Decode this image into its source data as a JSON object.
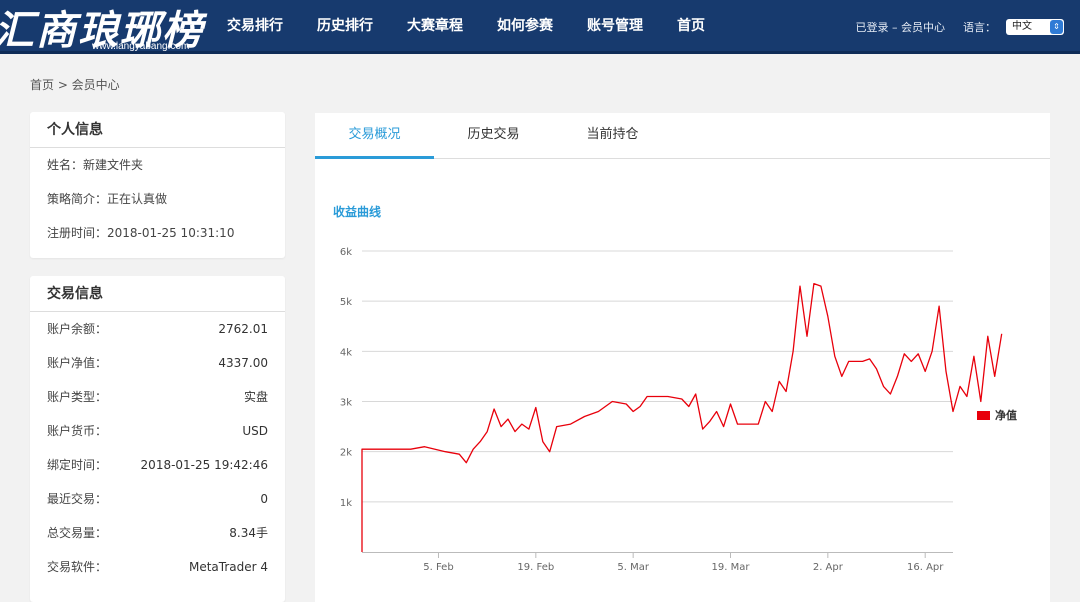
{
  "header": {
    "logo_text": "汇商琅琊榜",
    "logo_url": "www.langyabang.com",
    "nav": [
      "交易排行",
      "历史排行",
      "大赛章程",
      "如何参赛",
      "账号管理",
      "首页"
    ],
    "login_status": "已登录 – 会员中心",
    "language_label": "语言：",
    "language_value": "中文"
  },
  "breadcrumb": "首页 > 会员中心",
  "personal_info": {
    "title": "个人信息",
    "name": "姓名：新建文件夹",
    "strategy": "策略简介：正在认真做",
    "registered": "注册时间：2018-01-25 10:31:10"
  },
  "trade_info": {
    "title": "交易信息",
    "rows": [
      {
        "label": "账户余额：",
        "value": "2762.01"
      },
      {
        "label": "账户净值：",
        "value": "4337.00"
      },
      {
        "label": "账户类型：",
        "value": "实盘"
      },
      {
        "label": "账户货币：",
        "value": "USD"
      },
      {
        "label": "绑定时间：",
        "value": "2018-01-25 19:42:46"
      },
      {
        "label": "最近交易：",
        "value": "0"
      },
      {
        "label": "总交易量：",
        "value": "8.34手"
      },
      {
        "label": "交易软件：",
        "value": "MetaTrader 4"
      }
    ]
  },
  "tabs": [
    "交易概况",
    "历史交易",
    "当前持仓"
  ],
  "chart_title": "收益曲线",
  "colors": {
    "header": "#173a6e",
    "accent": "#2a9bd8",
    "series": "#e8000b"
  },
  "chart_data": {
    "type": "line",
    "title": "",
    "xlabel": "",
    "ylabel": "",
    "ylim": [
      0,
      6000
    ],
    "yticks": [
      {
        "v": 1000,
        "label": "1k"
      },
      {
        "v": 2000,
        "label": "2k"
      },
      {
        "v": 3000,
        "label": "3k"
      },
      {
        "v": 4000,
        "label": "4k"
      },
      {
        "v": 5000,
        "label": "5k"
      },
      {
        "v": 6000,
        "label": "6k"
      }
    ],
    "xlim": [
      "2018-01-25",
      "2018-04-20"
    ],
    "xticks": [
      {
        "date": "2018-02-05",
        "label": "5. Feb"
      },
      {
        "date": "2018-02-19",
        "label": "19. Feb"
      },
      {
        "date": "2018-03-05",
        "label": "5. Mar"
      },
      {
        "date": "2018-03-19",
        "label": "19. Mar"
      },
      {
        "date": "2018-04-02",
        "label": "2. Apr"
      },
      {
        "date": "2018-04-16",
        "label": "16. Apr"
      }
    ],
    "grid": true,
    "legend_position": "right",
    "series": [
      {
        "name": "净值",
        "points": [
          [
            "2018-01-25",
            0
          ],
          [
            "2018-01-25",
            2050
          ],
          [
            "2018-01-29",
            2050
          ],
          [
            "2018-02-01",
            2050
          ],
          [
            "2018-02-03",
            2100
          ],
          [
            "2018-02-06",
            2000
          ],
          [
            "2018-02-08",
            1950
          ],
          [
            "2018-02-09",
            1780
          ],
          [
            "2018-02-10",
            2050
          ],
          [
            "2018-02-11",
            2200
          ],
          [
            "2018-02-12",
            2400
          ],
          [
            "2018-02-13",
            2850
          ],
          [
            "2018-02-14",
            2500
          ],
          [
            "2018-02-15",
            2650
          ],
          [
            "2018-02-16",
            2400
          ],
          [
            "2018-02-17",
            2550
          ],
          [
            "2018-02-18",
            2450
          ],
          [
            "2018-02-19",
            2880
          ],
          [
            "2018-02-20",
            2200
          ],
          [
            "2018-02-21",
            2000
          ],
          [
            "2018-02-22",
            2500
          ],
          [
            "2018-02-24",
            2550
          ],
          [
            "2018-02-26",
            2700
          ],
          [
            "2018-02-28",
            2800
          ],
          [
            "2018-03-02",
            3000
          ],
          [
            "2018-03-04",
            2950
          ],
          [
            "2018-03-05",
            2800
          ],
          [
            "2018-03-06",
            2900
          ],
          [
            "2018-03-07",
            3100
          ],
          [
            "2018-03-10",
            3100
          ],
          [
            "2018-03-12",
            3050
          ],
          [
            "2018-03-13",
            2900
          ],
          [
            "2018-03-14",
            3150
          ],
          [
            "2018-03-15",
            2450
          ],
          [
            "2018-03-16",
            2600
          ],
          [
            "2018-03-17",
            2800
          ],
          [
            "2018-03-18",
            2500
          ],
          [
            "2018-03-19",
            2950
          ],
          [
            "2018-03-20",
            2550
          ],
          [
            "2018-03-23",
            2550
          ],
          [
            "2018-03-24",
            3000
          ],
          [
            "2018-03-25",
            2800
          ],
          [
            "2018-03-26",
            3400
          ],
          [
            "2018-03-27",
            3200
          ],
          [
            "2018-03-28",
            4000
          ],
          [
            "2018-03-29",
            5300
          ],
          [
            "2018-03-30",
            4300
          ],
          [
            "2018-03-31",
            5350
          ],
          [
            "2018-04-01",
            5300
          ],
          [
            "2018-04-02",
            4700
          ],
          [
            "2018-04-03",
            3900
          ],
          [
            "2018-04-04",
            3500
          ],
          [
            "2018-04-05",
            3800
          ],
          [
            "2018-04-07",
            3800
          ],
          [
            "2018-04-08",
            3850
          ],
          [
            "2018-04-09",
            3650
          ],
          [
            "2018-04-10",
            3300
          ],
          [
            "2018-04-11",
            3150
          ],
          [
            "2018-04-12",
            3500
          ],
          [
            "2018-04-13",
            3950
          ],
          [
            "2018-04-14",
            3800
          ],
          [
            "2018-04-15",
            3950
          ],
          [
            "2018-04-16",
            3600
          ],
          [
            "2018-04-17",
            4000
          ],
          [
            "2018-04-18",
            4900
          ],
          [
            "2018-04-19",
            3600
          ],
          [
            "2018-04-20",
            2800
          ],
          [
            "2018-04-21",
            3300
          ],
          [
            "2018-04-22",
            3100
          ],
          [
            "2018-04-23",
            3900
          ],
          [
            "2018-04-24",
            3000
          ],
          [
            "2018-04-25",
            4300
          ],
          [
            "2018-04-26",
            3500
          ],
          [
            "2018-04-27",
            4350
          ]
        ]
      }
    ]
  }
}
